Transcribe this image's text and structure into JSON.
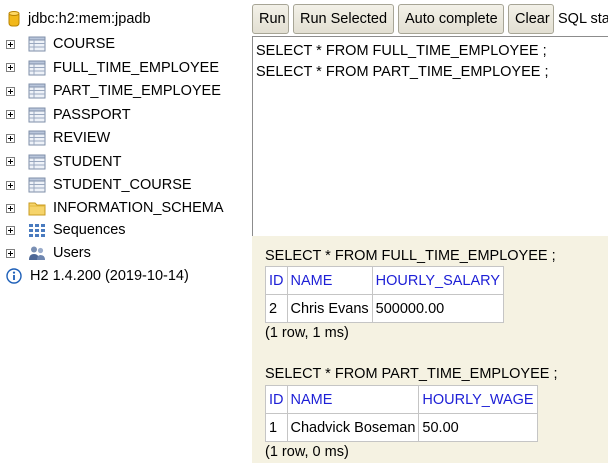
{
  "tree": {
    "connection": "jdbc:h2:mem:jpadb",
    "tables": [
      "COURSE",
      "FULL_TIME_EMPLOYEE",
      "PART_TIME_EMPLOYEE",
      "PASSPORT",
      "REVIEW",
      "STUDENT",
      "STUDENT_COURSE"
    ],
    "schema": "INFORMATION_SCHEMA",
    "sequences": "Sequences",
    "users": "Users",
    "version": "H2 1.4.200 (2019-10-14)"
  },
  "toolbar": {
    "run": "Run",
    "run_selected": "Run Selected",
    "auto_complete": "Auto complete",
    "clear": "Clear",
    "sql_label": "SQL statement:"
  },
  "editor": {
    "lines": [
      "SELECT * FROM FULL_TIME_EMPLOYEE ;",
      "SELECT * FROM PART_TIME_EMPLOYEE ;"
    ]
  },
  "results": [
    {
      "query": "SELECT * FROM FULL_TIME_EMPLOYEE ;",
      "columns": [
        "ID",
        "NAME",
        "HOURLY_SALARY"
      ],
      "rows": [
        [
          "2",
          "Chris Evans",
          "500000.00"
        ]
      ],
      "summary": "(1 row, 1 ms)"
    },
    {
      "query": "SELECT * FROM PART_TIME_EMPLOYEE ;",
      "columns": [
        "ID",
        "NAME",
        "HOURLY_WAGE"
      ],
      "rows": [
        [
          "1",
          "Chadvick Boseman",
          "50.00"
        ]
      ],
      "summary": "(1 row, 0 ms)"
    }
  ]
}
